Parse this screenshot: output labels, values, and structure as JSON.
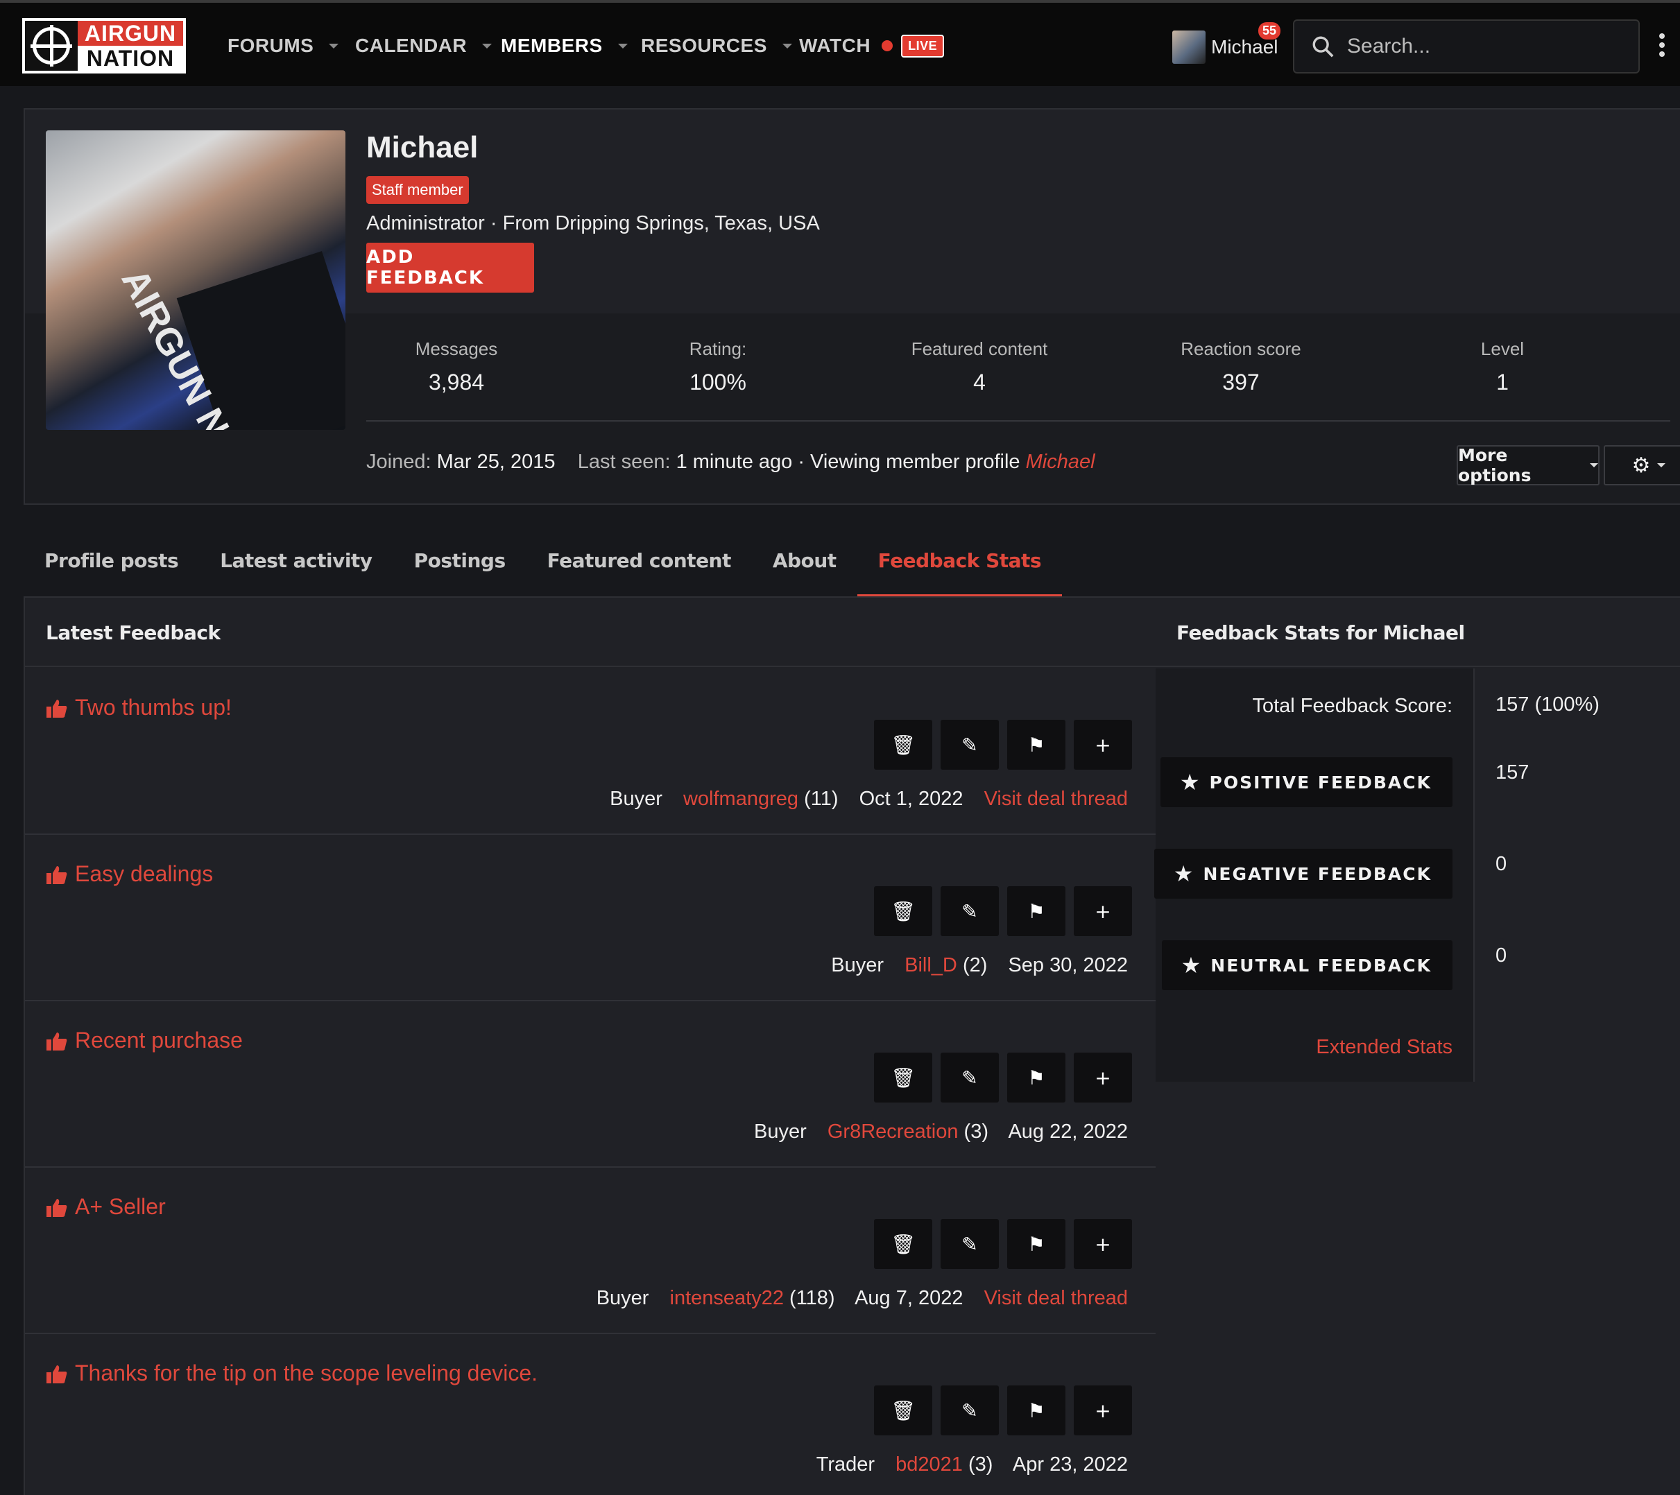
{
  "header": {
    "logo_top": "AIRGUN",
    "logo_bottom": "NATION",
    "nav": [
      {
        "label": "FORUMS"
      },
      {
        "label": "CALENDAR"
      },
      {
        "label": "MEMBERS"
      },
      {
        "label": "RESOURCES"
      },
      {
        "label": "WATCH"
      }
    ],
    "live_badge": "LIVE",
    "user_name": "Michael",
    "notification_count": "55",
    "search_placeholder": "Search..."
  },
  "profile": {
    "name": "Michael",
    "badge": "Staff member",
    "subline": "Administrator · From Dripping Springs, Texas, USA",
    "add_feedback_label": "ADD FEEDBACK",
    "avatar_text": "AIRGUN NATIO",
    "stats": [
      {
        "label": "Messages",
        "value": "3,984"
      },
      {
        "label": "Rating:",
        "value": "100%"
      },
      {
        "label": "Featured content",
        "value": "4"
      },
      {
        "label": "Reaction score",
        "value": "397"
      },
      {
        "label": "Level",
        "value": "1"
      }
    ],
    "joined_label": "Joined:",
    "joined_value": "Mar 25, 2015",
    "last_seen_label": "Last seen:",
    "last_seen_value": "1 minute ago · Viewing member profile",
    "last_seen_link": "Michael",
    "more_options_label": "More options"
  },
  "tabs": [
    {
      "label": "Profile posts"
    },
    {
      "label": "Latest activity"
    },
    {
      "label": "Postings"
    },
    {
      "label": "Featured content"
    },
    {
      "label": "About"
    },
    {
      "label": "Feedback Stats"
    }
  ],
  "latest_feedback": {
    "heading": "Latest Feedback",
    "items": [
      {
        "title": "Two thumbs up!",
        "role": "Buyer",
        "user": "wolfmangreg",
        "count": "(11)",
        "date": "Oct 1, 2022",
        "link": "Visit deal thread"
      },
      {
        "title": "Easy dealings",
        "role": "Buyer",
        "user": "Bill_D",
        "count": "(2)",
        "date": "Sep 30, 2022",
        "link": ""
      },
      {
        "title": "Recent purchase",
        "role": "Buyer",
        "user": "Gr8Recreation",
        "count": "(3)",
        "date": "Aug 22, 2022",
        "link": ""
      },
      {
        "title": "A+ Seller",
        "role": "Buyer",
        "user": "intenseaty22",
        "count": "(118)",
        "date": "Aug 7, 2022",
        "link": "Visit deal thread"
      },
      {
        "title": "Thanks for the tip on the scope leveling device.",
        "role": "Trader",
        "user": "bd2021",
        "count": "(3)",
        "date": "Apr 23, 2022",
        "link": ""
      }
    ]
  },
  "feedback_stats": {
    "heading": "Feedback Stats for Michael",
    "total_label": "Total Feedback Score:",
    "total_value": "157 (100%)",
    "positive_label": "POSITIVE FEEDBACK",
    "positive_value": "157",
    "negative_label": "NEGATIVE FEEDBACK",
    "negative_value": "0",
    "neutral_label": "NEUTRAL FEEDBACK",
    "neutral_value": "0",
    "extended_link": "Extended Stats"
  },
  "colors": {
    "accent": "#e0483c",
    "background": "#17181c",
    "panel": "#202126"
  }
}
